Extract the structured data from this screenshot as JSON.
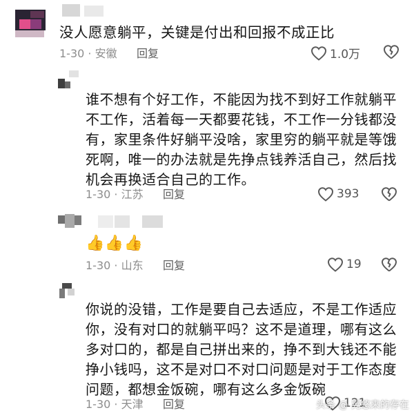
{
  "comments": [
    {
      "text": "没人愿意躺平，关键是付出和回报不成正比",
      "meta": "1-30 · 安徽",
      "reply": "回复",
      "likes": "1.0万"
    },
    {
      "text": "谁不想有个好工作，不能因为找不到好工作就躺平不工作，活着每一天都要花钱，不工作一分钱都没有，家里条件好躺平没啥，家里穷的躺平就是等饿死啊，唯一的办法就是先挣点钱养活自己，然后找机会再换适合自己的工作。",
      "meta": "1-30 · 江苏",
      "reply": "回复",
      "likes": "393"
    },
    {
      "text": "👍👍👍",
      "meta": "1-30 · 山东",
      "reply": "回复",
      "likes": "19"
    },
    {
      "text": "你说的没错，工作是要自己去适应，不是工作适应你，没有对口的就躺平吗？这不是道理，哪有这么多对口的，都是自己拼出来的，挣不到大钱还不能挣小钱吗，这不是对口不对口问题是对于工作态度问题，都想金饭碗，哪有这么多金饭碗",
      "meta": "1-30 · 天津",
      "reply": "回复",
      "likes": "121"
    }
  ],
  "watermark": "头条 @ 晃悠来的存在"
}
